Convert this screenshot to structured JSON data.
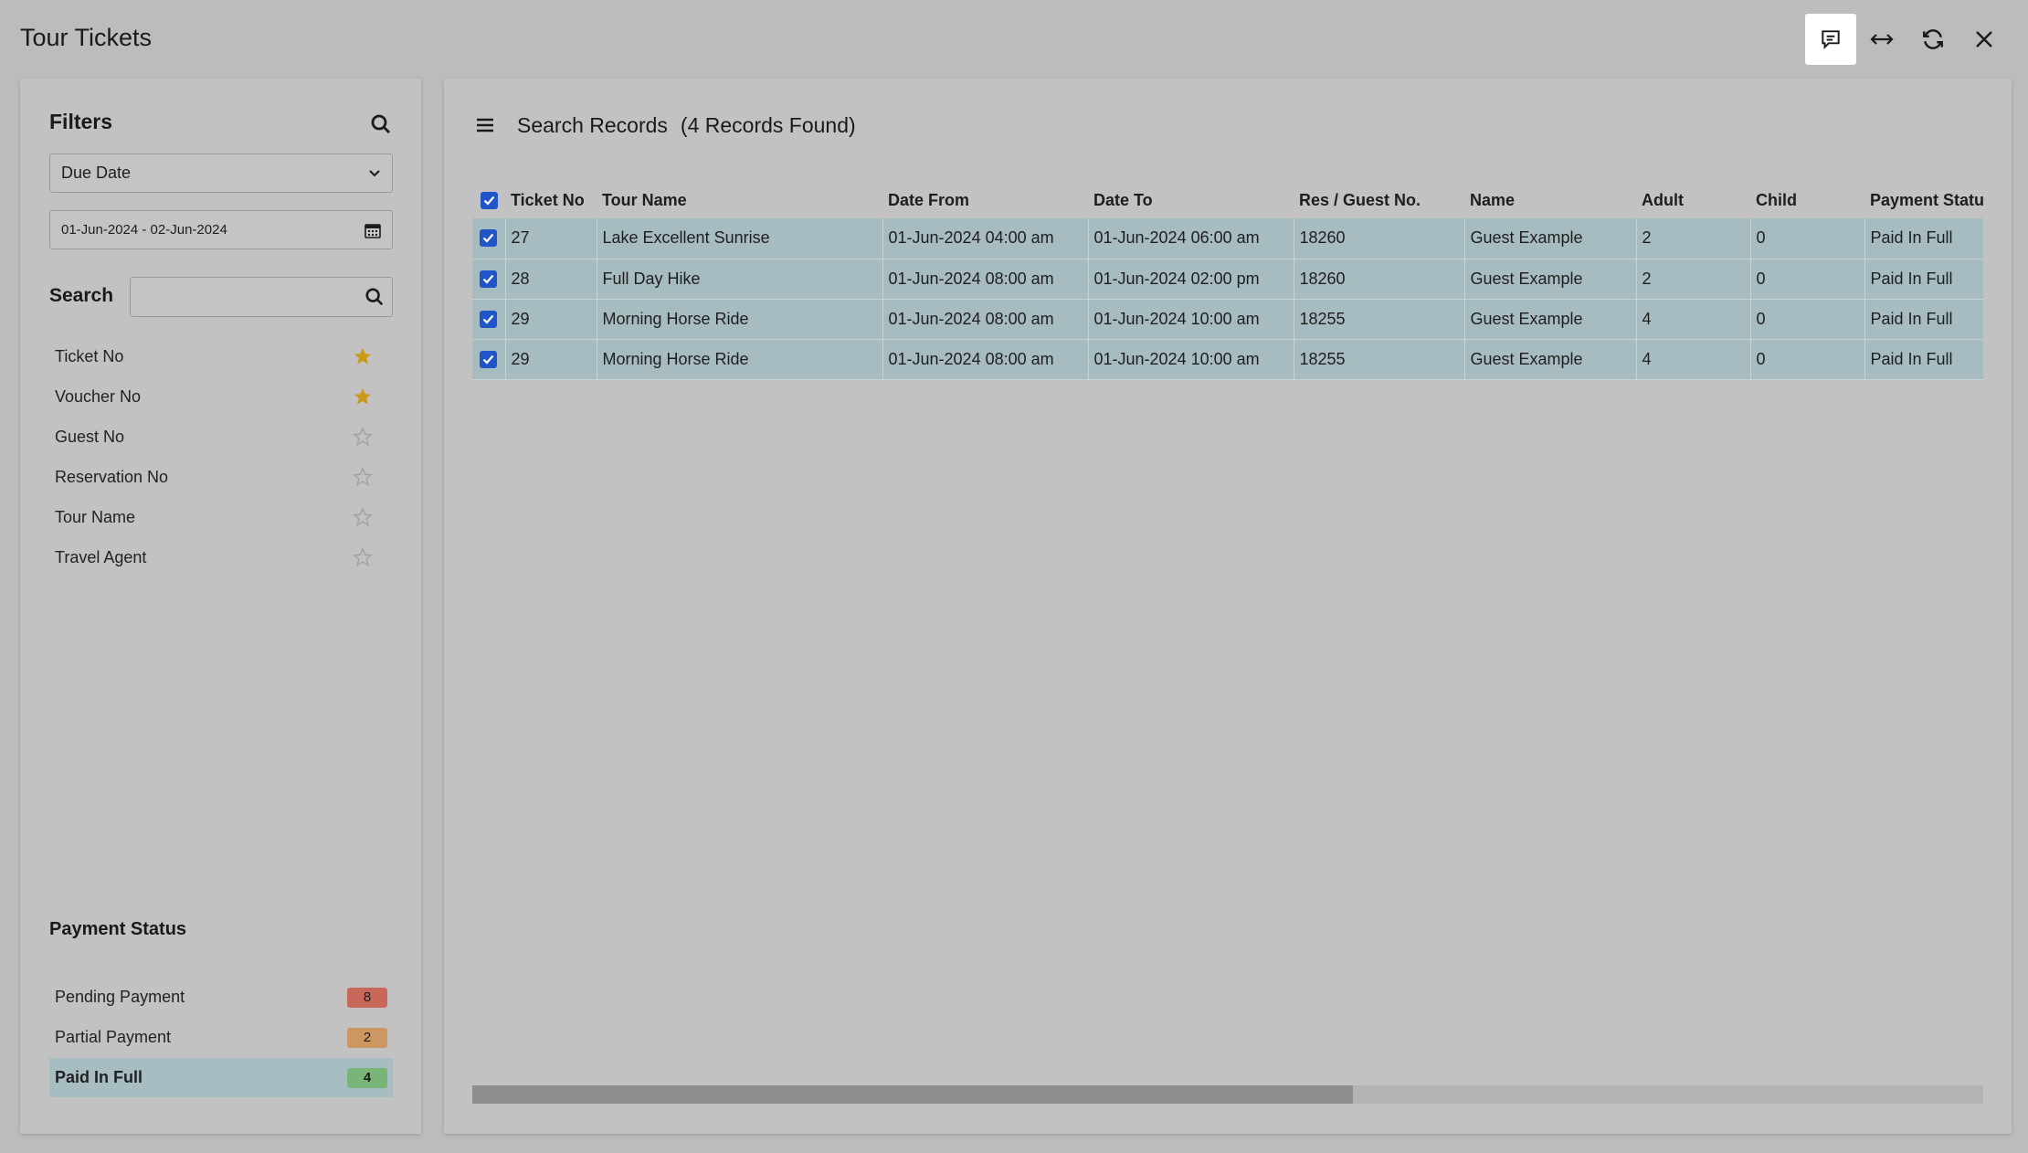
{
  "app": {
    "title": "Tour Tickets"
  },
  "window_controls": [
    {
      "name": "comment-icon",
      "active": true
    },
    {
      "name": "expand-horizontal-icon",
      "active": false
    },
    {
      "name": "refresh-icon",
      "active": false
    },
    {
      "name": "close-icon",
      "active": false
    }
  ],
  "filters": {
    "title": "Filters",
    "date_type": "Due Date",
    "date_range": "01-Jun-2024 - 02-Jun-2024",
    "search_label": "Search",
    "search_value": "",
    "fields": [
      {
        "label": "Ticket No",
        "favorite": true
      },
      {
        "label": "Voucher No",
        "favorite": true
      },
      {
        "label": "Guest No",
        "favorite": false
      },
      {
        "label": "Reservation No",
        "favorite": false
      },
      {
        "label": "Tour Name",
        "favorite": false
      },
      {
        "label": "Travel Agent",
        "favorite": false
      }
    ],
    "payment_status_title": "Payment Status",
    "payment_statuses": [
      {
        "label": "Pending Payment",
        "count": "8",
        "color": "#c9685a",
        "selected": false
      },
      {
        "label": "Partial Payment",
        "count": "2",
        "color": "#cc9760",
        "selected": false
      },
      {
        "label": "Paid In Full",
        "count": "4",
        "color": "#79b578",
        "selected": true
      }
    ]
  },
  "records": {
    "title": "Search Records",
    "count_text": "(4 Records Found)",
    "columns": [
      "Ticket No",
      "Tour Name",
      "Date From",
      "Date To",
      "Res / Guest No.",
      "Name",
      "Adult",
      "Child",
      "Payment Status"
    ],
    "rows": [
      [
        "27",
        "Lake Excellent Sunrise",
        "01-Jun-2024 04:00 am",
        "01-Jun-2024 06:00 am",
        "18260",
        "Guest Example",
        "2",
        "0",
        "Paid In Full"
      ],
      [
        "28",
        "Full Day Hike",
        "01-Jun-2024 08:00 am",
        "01-Jun-2024 02:00 pm",
        "18260",
        "Guest Example",
        "2",
        "0",
        "Paid In Full"
      ],
      [
        "29",
        "Morning Horse Ride",
        "01-Jun-2024 08:00 am",
        "01-Jun-2024 10:00 am",
        "18255",
        "Guest Example",
        "4",
        "0",
        "Paid In Full"
      ],
      [
        "29",
        "Morning Horse Ride",
        "01-Jun-2024 08:00 am",
        "01-Jun-2024 10:00 am",
        "18255",
        "Guest Example",
        "4",
        "0",
        "Paid In Full"
      ]
    ]
  },
  "colors": {
    "accent": "#1f55c8",
    "row_selected": "#a7bcc1",
    "star_active": "#c99a16",
    "star_inactive": "#a4a4a4"
  }
}
